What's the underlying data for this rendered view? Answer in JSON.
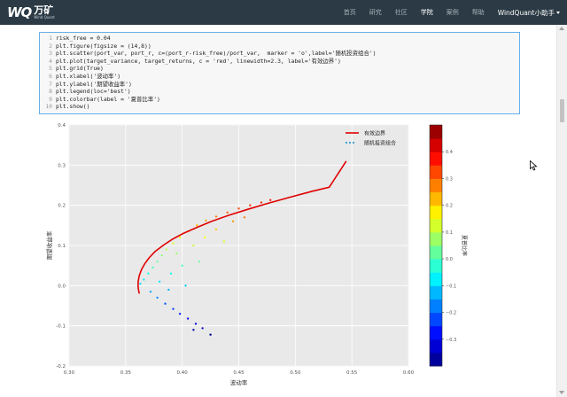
{
  "navbar": {
    "logo_mark": "WQ",
    "logo_cn": "万矿",
    "logo_en": "Wind Quant",
    "links": [
      {
        "label": "首页",
        "active": false
      },
      {
        "label": "研究",
        "active": false
      },
      {
        "label": "社区",
        "active": false
      },
      {
        "label": "学院",
        "active": true
      },
      {
        "label": "案例",
        "active": false
      },
      {
        "label": "帮助",
        "active": false
      }
    ],
    "user": "WindQuant小助手"
  },
  "code": {
    "lines": [
      {
        "n": "1",
        "text": "risk_free = 0.04"
      },
      {
        "n": "2",
        "text": "plt.figure(figsize = (14,8))"
      },
      {
        "n": "3",
        "text": "plt.scatter(port_var, port_r, c=(port_r-risk_free)/port_var,  marker = 'o',label='随机投资组合')"
      },
      {
        "n": "4",
        "text": "plt.plot(target_variance, target_returns, c = 'red', linewidth=2.3, label='有效边界')"
      },
      {
        "n": "5",
        "text": "plt.grid(True)"
      },
      {
        "n": "6",
        "text": "plt.xlabel('波动率')"
      },
      {
        "n": "7",
        "text": "plt.ylabel('期望收益率')"
      },
      {
        "n": "8",
        "text": "plt.legend(loc='best')"
      },
      {
        "n": "9",
        "text": "plt.colorbar(label = '夏普比率')"
      },
      {
        "n": "10",
        "text": "plt.show()"
      }
    ]
  },
  "chart_data": {
    "type": "scatter",
    "xlabel": "波动率",
    "ylabel": "期望收益率",
    "xlim": [
      0.3,
      0.6
    ],
    "ylim": [
      -0.2,
      0.4
    ],
    "xticks": [
      "0.30",
      "0.35",
      "0.40",
      "0.45",
      "0.50",
      "0.55",
      "0.60"
    ],
    "yticks": [
      "-0.2",
      "-0.1",
      "0.0",
      "0.1",
      "0.2",
      "0.3",
      "0.4"
    ],
    "grid": true,
    "legend_position": "top-right",
    "legend": [
      {
        "label": "有效边界",
        "color": "#e00000"
      },
      {
        "label": "随机投资组合",
        "color": "#3aa0d0"
      }
    ],
    "frontier": {
      "name": "有效边界",
      "color": "#e00000",
      "points": [
        [
          0.362,
          -0.02
        ],
        [
          0.361,
          -0.005
        ],
        [
          0.361,
          0.01
        ],
        [
          0.362,
          0.025
        ],
        [
          0.364,
          0.04
        ],
        [
          0.367,
          0.055
        ],
        [
          0.371,
          0.07
        ],
        [
          0.376,
          0.085
        ],
        [
          0.383,
          0.1
        ],
        [
          0.391,
          0.115
        ],
        [
          0.401,
          0.13
        ],
        [
          0.413,
          0.145
        ],
        [
          0.426,
          0.16
        ],
        [
          0.441,
          0.175
        ],
        [
          0.458,
          0.19
        ],
        [
          0.476,
          0.205
        ],
        [
          0.495,
          0.22
        ],
        [
          0.515,
          0.235
        ],
        [
          0.53,
          0.245
        ],
        [
          0.545,
          0.31
        ]
      ]
    },
    "scatter_sample": {
      "name": "随机投资组合",
      "points": [
        [
          0.363,
          0.005
        ],
        [
          0.366,
          0.015
        ],
        [
          0.37,
          0.03
        ],
        [
          0.374,
          0.045
        ],
        [
          0.378,
          0.06
        ],
        [
          0.382,
          0.075
        ],
        [
          0.386,
          0.09
        ],
        [
          0.392,
          0.105
        ],
        [
          0.398,
          0.12
        ],
        [
          0.405,
          0.135
        ],
        [
          0.413,
          0.15
        ],
        [
          0.421,
          0.162
        ],
        [
          0.43,
          0.172
        ],
        [
          0.44,
          0.182
        ],
        [
          0.45,
          0.192
        ],
        [
          0.46,
          0.2
        ],
        [
          0.47,
          0.207
        ],
        [
          0.478,
          0.213
        ],
        [
          0.372,
          -0.015
        ],
        [
          0.378,
          -0.03
        ],
        [
          0.385,
          -0.045
        ],
        [
          0.392,
          -0.058
        ],
        [
          0.398,
          -0.07
        ],
        [
          0.405,
          -0.082
        ],
        [
          0.412,
          -0.095
        ],
        [
          0.418,
          -0.106
        ],
        [
          0.425,
          -0.122
        ],
        [
          0.38,
          0.01
        ],
        [
          0.39,
          0.03
        ],
        [
          0.4,
          0.05
        ],
        [
          0.395,
          0.08
        ],
        [
          0.41,
          0.1
        ],
        [
          0.42,
          0.12
        ],
        [
          0.403,
          0.0
        ],
        [
          0.388,
          -0.01
        ],
        [
          0.415,
          0.06
        ],
        [
          0.43,
          0.14
        ],
        [
          0.445,
          0.16
        ],
        [
          0.455,
          0.17
        ],
        [
          0.437,
          0.11
        ]
      ]
    },
    "colorbar": {
      "label": "夏普比率",
      "range": [
        -0.4,
        0.5
      ],
      "ticks": [
        "0.4",
        "0.3",
        "0.2",
        "0.1",
        "0.0",
        "−0.1",
        "−0.2",
        "−0.3"
      ]
    }
  }
}
